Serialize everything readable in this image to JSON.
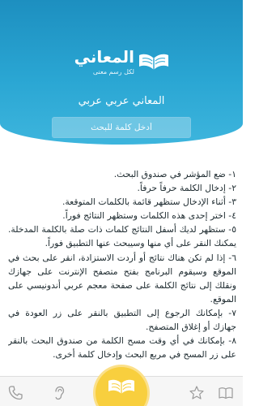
{
  "header": {
    "logo_word": "المعاني",
    "logo_tagline": "لكل رسم معنى",
    "subtitle": "المعاني عربي عربي",
    "search_placeholder": "أدخل كلمة للبحث"
  },
  "instructions": [
    "١- ضع المؤشر في صندوق البحث.",
    "٢- إدخال الكلمة حرفاً حرفاً.",
    "٣- أثناء الإدخال ستظهر قائمة بالكلمات المتوقعة.",
    "٤- اختر إحدى هذه الكلمات وستظهر النتائج فوراً.",
    "٥- ستظهر لديك أسفل النتائج كلمات ذات صلة بالكلمة المدخلة. يمكنك النقر على أي منها وسيبحث عنها التطبيق فوراً.",
    "٦- إذا لم تكن هناك نتائج أو أردت الاستزادة، انقر على بحث في الموقع وسيقوم البرنامج بفتح متصفح الإنترنت على جهازك ونقلك إلى نتائج الكلمة على صفحة معجم عربي أندونيسي على الموقع.",
    "٧- بإمكانك الرجوع إلى التطبيق بالنقر على زر العودة في جهازك أو إغلاق المتصفح.",
    "٨- بإمكانك في أي وقت مسح الكلمة من صندوق البحث بالنقر على زر المسح في مربع البحث وإدخال كلمة أخرى."
  ],
  "tabbar": {
    "icons": [
      "phone-icon",
      "ear-icon",
      "book-icon",
      "star-icon",
      "open-book-icon"
    ],
    "accent": "#f8cf3e",
    "bar_bg": "#f6f6f6",
    "icon_color": "#9a9a9a"
  },
  "colors": {
    "header_top": "#1d8fc0",
    "header_bottom": "#3db5dd",
    "text": "#1d2a2f"
  }
}
